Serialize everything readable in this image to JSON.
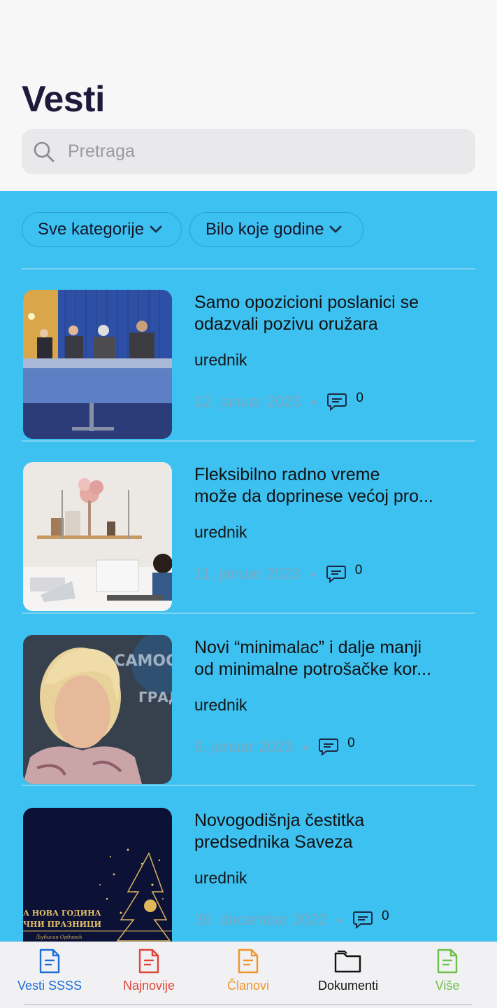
{
  "header": {
    "title": "Vesti"
  },
  "search": {
    "placeholder": "Pretraga",
    "icon": "search-icon"
  },
  "filters": [
    {
      "label": "Sve kategorije",
      "icon": "chevron-down-icon"
    },
    {
      "label": "Bilo koje godine",
      "icon": "chevron-down-icon"
    }
  ],
  "articles": [
    {
      "title_line1": "Samo opozicioni poslanici se",
      "title_line2": "odazvali pozivu oružara",
      "author": "urednik",
      "date": "12. januar 2023",
      "comments": "0"
    },
    {
      "title_line1": "Fleksibilno radno vreme",
      "title_line2": "može da doprinese većoj pro...",
      "author": "urednik",
      "date": "11. januar 2023",
      "comments": "0"
    },
    {
      "title_line1": "Novi “minimalac” i dalje manji",
      "title_line2": "od minimalne potrošačke kor...",
      "author": "urednik",
      "date": "9. januar 2023",
      "comments": "0",
      "image_text_1": "ЕЗ САМОСТ",
      "image_text_2": "ГРАД"
    },
    {
      "title_line1": "Novogodišnja čestitka",
      "title_line2": "predsednika Saveza",
      "author": "urednik",
      "date": "30. decembar 2022",
      "comments": "0",
      "image_text_1": "А НОВА ГОДИНА",
      "image_text_2": "ЧНИ ПРАЗНИЦИ",
      "image_text_3": "Љубисав Орбовић"
    }
  ],
  "tabs": [
    {
      "label": "Vesti SSSS",
      "color": "#1d6fd6",
      "icon": "document-icon"
    },
    {
      "label": "Najnovije",
      "color": "#e0453a",
      "icon": "document-icon"
    },
    {
      "label": "Članovi",
      "color": "#f0962a",
      "icon": "document-icon"
    },
    {
      "label": "Dokumenti",
      "color": "#111111",
      "icon": "folder-icon"
    },
    {
      "label": "Više",
      "color": "#6dc04b",
      "icon": "document-icon"
    }
  ],
  "colors": {
    "content_bg": "#3dc1f1",
    "title": "#1d1a3a"
  }
}
